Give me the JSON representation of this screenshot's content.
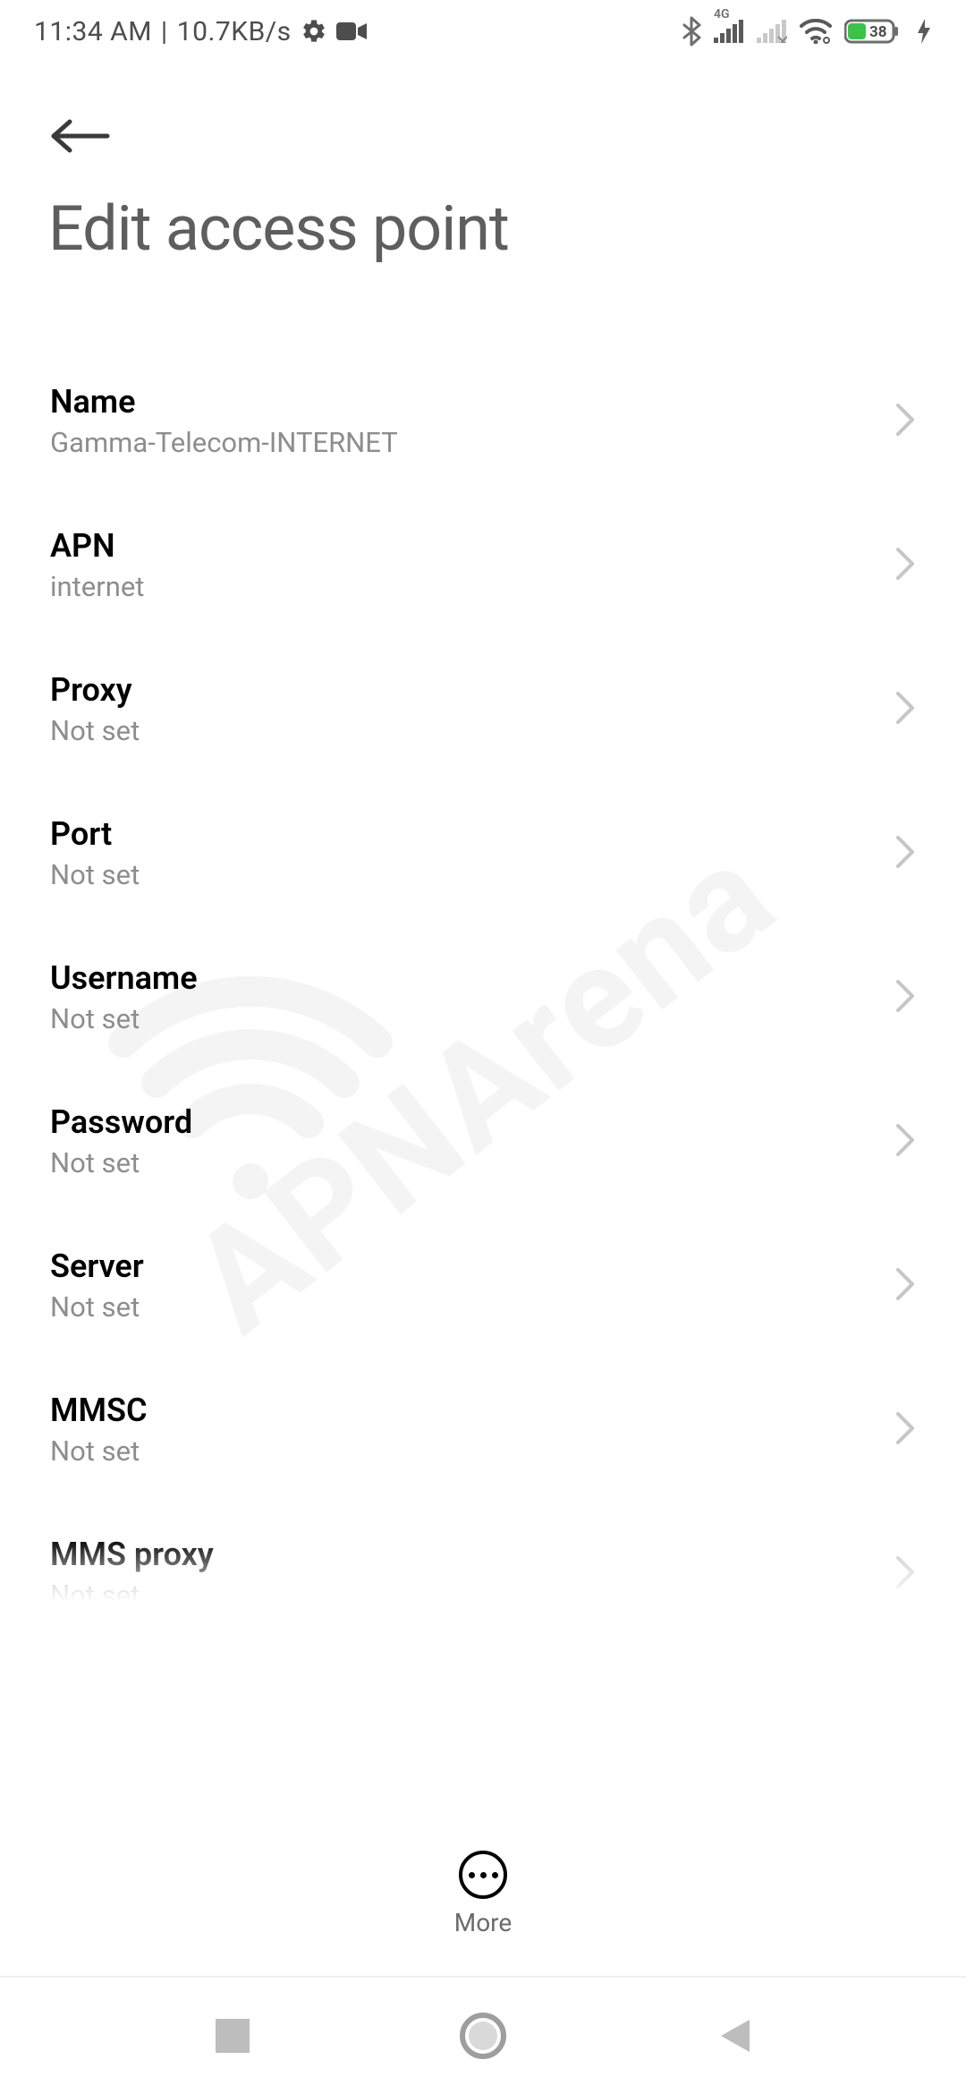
{
  "status_bar": {
    "time": "11:34 AM",
    "separator": "|",
    "speed": "10.7KB/s",
    "network_label": "4G",
    "battery_percent": "38"
  },
  "header": {
    "title": "Edit access point"
  },
  "settings": [
    {
      "label": "Name",
      "value": "Gamma-Telecom-INTERNET"
    },
    {
      "label": "APN",
      "value": "internet"
    },
    {
      "label": "Proxy",
      "value": "Not set"
    },
    {
      "label": "Port",
      "value": "Not set"
    },
    {
      "label": "Username",
      "value": "Not set"
    },
    {
      "label": "Password",
      "value": "Not set"
    },
    {
      "label": "Server",
      "value": "Not set"
    },
    {
      "label": "MMSC",
      "value": "Not set"
    },
    {
      "label": "MMS proxy",
      "value": "Not set"
    }
  ],
  "bottom_action": {
    "label": "More"
  },
  "watermark": {
    "text": "APNArena"
  }
}
